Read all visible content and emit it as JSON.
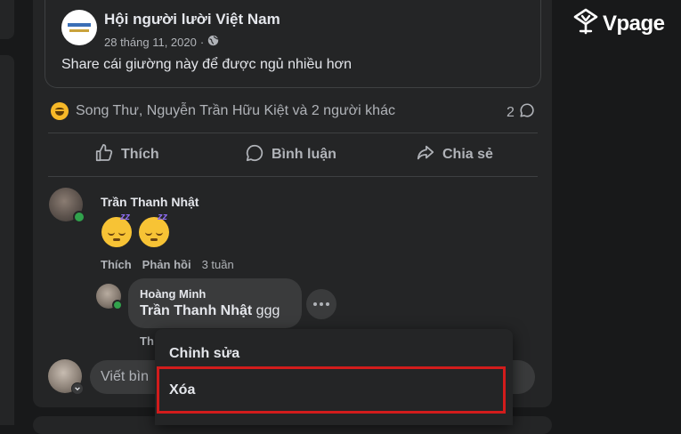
{
  "shared_post": {
    "page_name": "Hội người lười Việt Nam",
    "date": "28 tháng 11, 2020",
    "separator": "·",
    "text": "Share cái giường này để được ngủ nhiều hơn"
  },
  "reactions": {
    "summary": "Song Thư, Nguyễn Trần Hữu Kiệt và 2 người khác",
    "comment_count": "2"
  },
  "actions": {
    "like": "Thích",
    "comment": "Bình luận",
    "share": "Chia sẻ"
  },
  "comments": [
    {
      "author": "Trần Thanh Nhật",
      "like": "Thích",
      "reply": "Phản hồi",
      "time": "3 tuần"
    },
    {
      "author": "Hoàng Minh",
      "mention": "Trần Thanh Nhật",
      "text": " ggg",
      "partial_action": "Th"
    }
  ],
  "composer": {
    "placeholder": "Viết bìn"
  },
  "context_menu": {
    "edit": "Chỉnh sửa",
    "delete": "Xóa"
  },
  "brand": {
    "name": "Vpage"
  },
  "colors": {
    "background": "#18191a",
    "card": "#242526",
    "bubble": "#3a3b3c",
    "text": "#e4e6eb",
    "muted": "#b0b3b8",
    "online": "#31a24c",
    "highlight": "#d21c1c"
  }
}
